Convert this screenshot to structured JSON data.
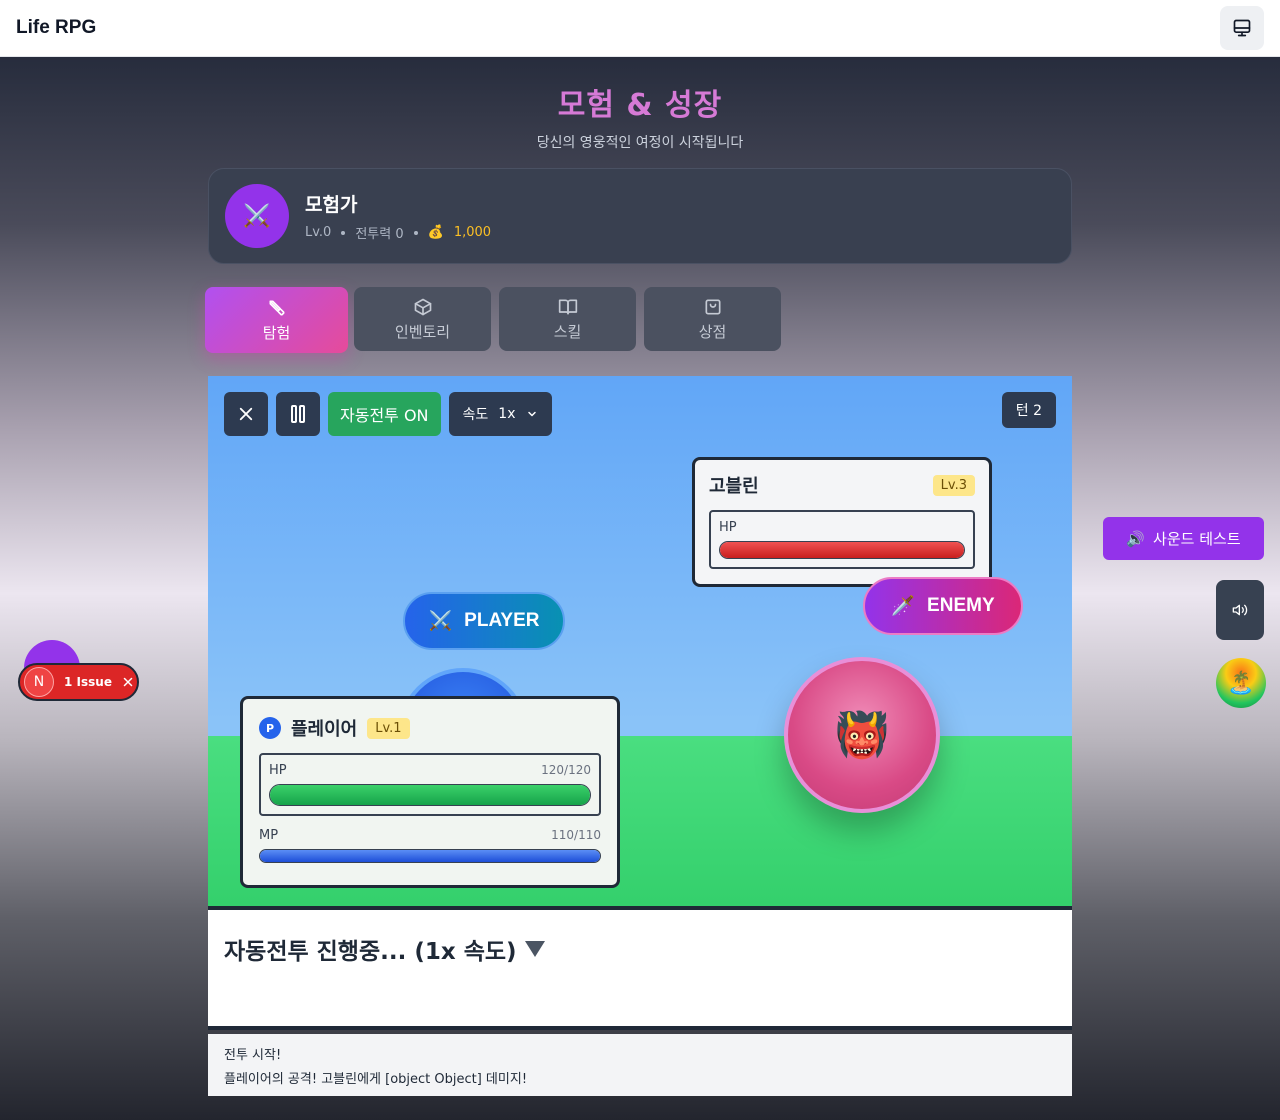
{
  "app": {
    "title": "Life RPG"
  },
  "header": {
    "title": "모험 & 성장",
    "subtitle": "당신의 영웅적인 여정이 시작됩니다"
  },
  "profile": {
    "avatar_icon": "⚔️",
    "name": "모험가",
    "level": "Lv.0",
    "power": "전투력 0",
    "gold_icon": "💰",
    "gold": "1,000"
  },
  "tabs": [
    {
      "label": "탐험",
      "icon": "sword-icon",
      "active": true
    },
    {
      "label": "인벤토리",
      "icon": "box-icon",
      "active": false
    },
    {
      "label": "스킬",
      "icon": "book-icon",
      "active": false
    },
    {
      "label": "상점",
      "icon": "bag-icon",
      "active": false
    }
  ],
  "battle": {
    "controls": {
      "auto_battle": "자동전투 ON",
      "speed_label": "속도",
      "speed_value": "1x"
    },
    "turn": "턴 2",
    "enemy": {
      "name": "고블린",
      "level": "Lv.3",
      "hp_label": "HP",
      "hp_fraction": 1.0,
      "tag": "ENEMY",
      "tag_icon": "🗡️",
      "portrait": "👹"
    },
    "player": {
      "badge": "P",
      "name": "플레이어",
      "level": "Lv.1",
      "hp_label": "HP",
      "hp_text": "120/120",
      "hp_fraction": 1.0,
      "mp_label": "MP",
      "mp_text": "110/110",
      "mp_fraction": 1.0,
      "tag": "PLAYER",
      "tag_icon": "⚔️"
    }
  },
  "status": {
    "text": "자동전투 진행중... (1x 속도)"
  },
  "log": [
    "전투 시작!",
    "플레이어의 공격! 고블린에게 [object Object] 데미지!"
  ],
  "side": {
    "sound_test": "사운드 테스트",
    "sound_icon": "🔊",
    "island_icon": "🏝️"
  },
  "issue": {
    "initial": "N",
    "label": "1 Issue"
  },
  "colors": {
    "accent": "#9333ea",
    "title": "#d67ad6",
    "auto_on": "#27a55d",
    "hp_player": "#16a34a",
    "hp_enemy": "#c81e1e",
    "mp": "#1d4ed8"
  }
}
